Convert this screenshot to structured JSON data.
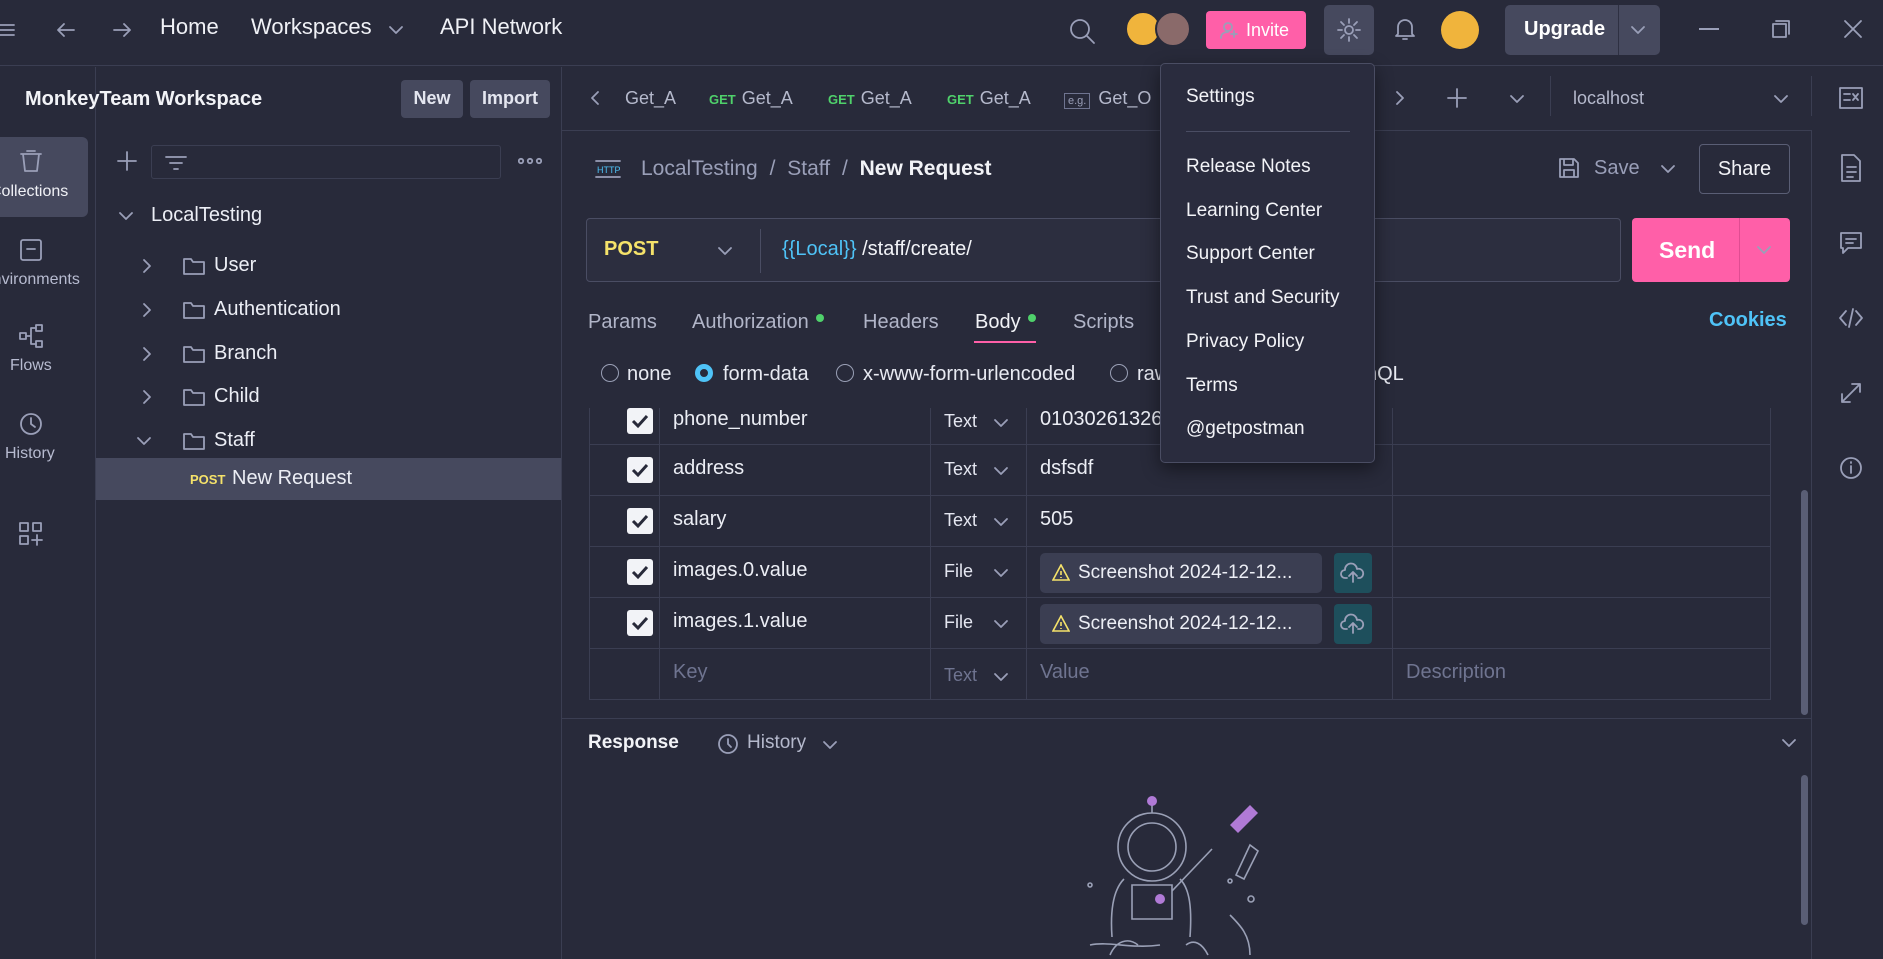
{
  "topbar": {
    "home": "Home",
    "workspaces": "Workspaces",
    "api_network": "API Network",
    "invite": "Invite",
    "upgrade": "Upgrade"
  },
  "sidebar": {
    "workspace_name": "MonkeyTeam Workspace",
    "new_label": "New",
    "import_label": "Import",
    "collection": "LocalTesting",
    "folders": [
      "User",
      "Authentication",
      "Branch",
      "Child",
      "Staff"
    ],
    "request_method": "POST",
    "request_name": "New Request"
  },
  "rail": {
    "items": [
      "Collections",
      "Environments",
      "Flows",
      "History"
    ]
  },
  "tabs": {
    "items": [
      {
        "method": "",
        "label": "Get_A"
      },
      {
        "method": "GET",
        "label": "Get_A"
      },
      {
        "method": "GET",
        "label": "Get_A"
      },
      {
        "method": "GET",
        "label": "Get_A"
      },
      {
        "method": "e.g.",
        "label": "Get_O"
      }
    ],
    "environment": "localhost"
  },
  "request": {
    "breadcrumb": [
      "LocalTesting",
      "Staff",
      "New Request"
    ],
    "save": "Save",
    "share": "Share",
    "method": "POST",
    "url_var": "{{Local}}",
    "url_path": " /staff/create/",
    "send": "Send",
    "subtabs": [
      "Params",
      "Authorization",
      "Headers",
      "Body",
      "Scripts"
    ],
    "cookies": "Cookies",
    "body_modes": [
      "none",
      "form-data",
      "x-www-form-urlencoded",
      "raw",
      "hQL"
    ],
    "selected_mode": "form-data"
  },
  "form_rows": [
    {
      "key": "phone_number",
      "type": "Text",
      "value": "01030261326"
    },
    {
      "key": "address",
      "type": "Text",
      "value": "dsfsdf"
    },
    {
      "key": "salary",
      "type": "Text",
      "value": "505"
    },
    {
      "key": "images.0.value",
      "type": "File",
      "value": "Screenshot 2024-12-12..."
    },
    {
      "key": "images.1.value",
      "type": "File",
      "value": "Screenshot 2024-12-12..."
    }
  ],
  "placeholder_row": {
    "key": "Key",
    "type": "Text",
    "value": "Value",
    "description": "Description"
  },
  "response": {
    "title": "Response",
    "history": "History"
  },
  "settings_menu": {
    "items": [
      "Settings",
      "Release Notes",
      "Learning Center",
      "Support Center",
      "Trust and Security",
      "Privacy Policy",
      "Terms",
      "@getpostman"
    ]
  },
  "colors": {
    "accent_pink": "#ff5fa8",
    "url_var": "#4fc3f7",
    "get_green": "#4fd16b",
    "post_yellow": "#f5e26a"
  }
}
